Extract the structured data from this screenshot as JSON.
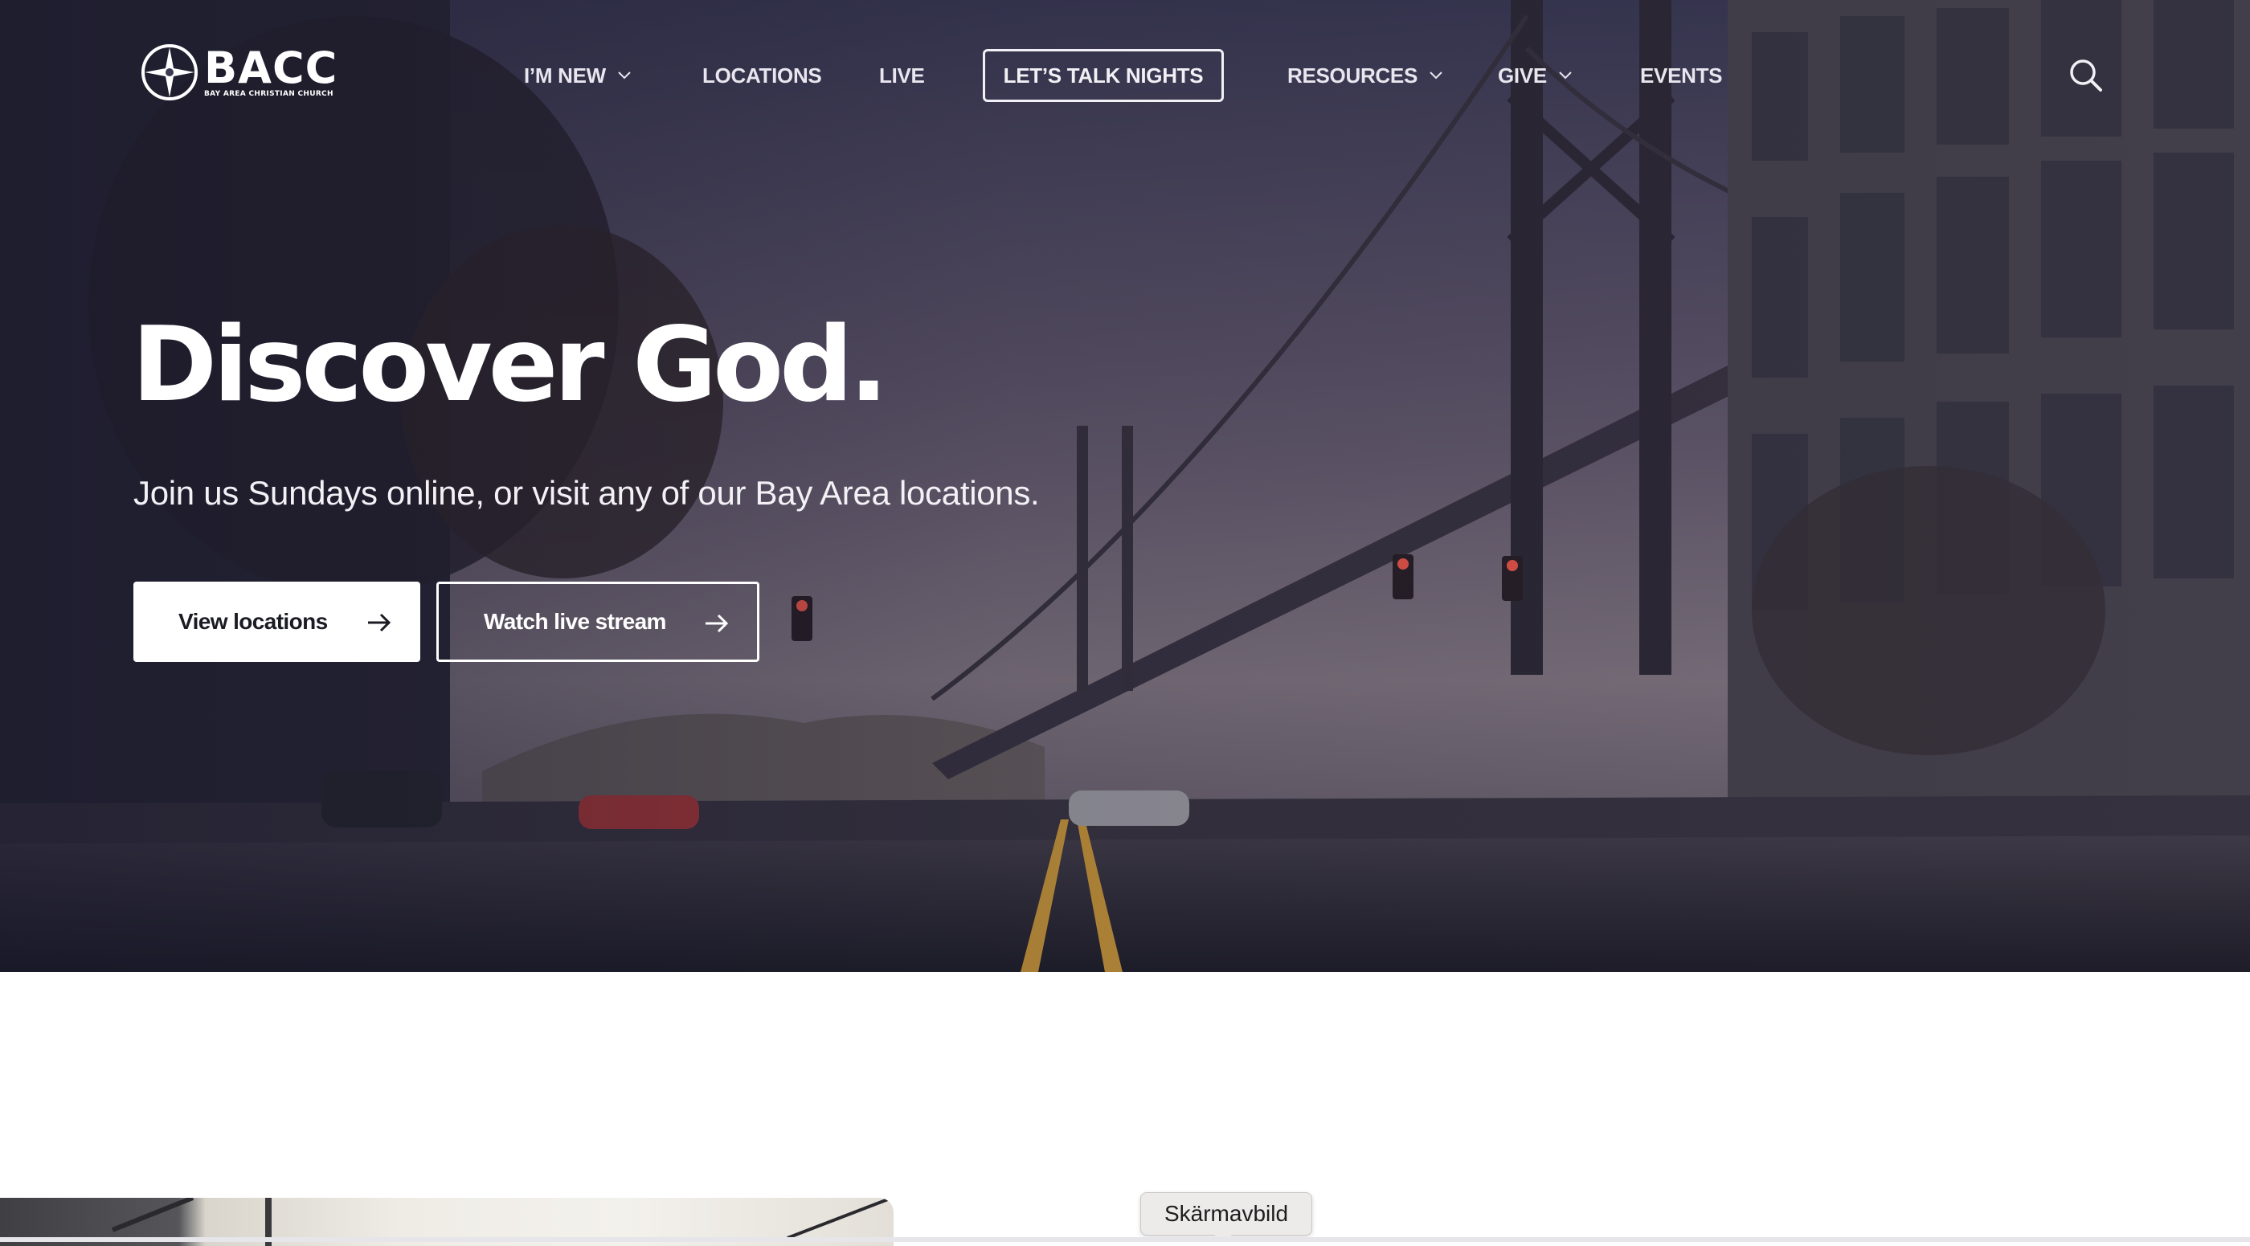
{
  "brand": {
    "name": "BACC",
    "tagline": "BAY AREA CHRISTIAN CHURCH"
  },
  "nav": {
    "items": [
      {
        "label": "I’M NEW",
        "has_dropdown": true
      },
      {
        "label": "LOCATIONS",
        "has_dropdown": false
      },
      {
        "label": "LIVE",
        "has_dropdown": false
      },
      {
        "label": "LET’S TALK NIGHTS",
        "has_dropdown": false,
        "outlined": true
      },
      {
        "label": "RESOURCES",
        "has_dropdown": true
      },
      {
        "label": "GIVE",
        "has_dropdown": true
      },
      {
        "label": "EVENTS",
        "has_dropdown": false
      }
    ],
    "search_icon": "search-icon"
  },
  "hero": {
    "headline": "Discover God.",
    "subline": "Join us Sundays online, or visit any of our Bay Area locations.",
    "primary_button": "View locations",
    "secondary_button": "Watch live stream",
    "arrow_icon": "arrow-right-icon"
  },
  "tooltip": {
    "text": "Skärmavbild"
  },
  "colors": {
    "hero_overlay": "#2b2a40",
    "text_light": "#ffffff",
    "button_text_dark": "#1b1b24",
    "road_line": "#d9a23a"
  }
}
